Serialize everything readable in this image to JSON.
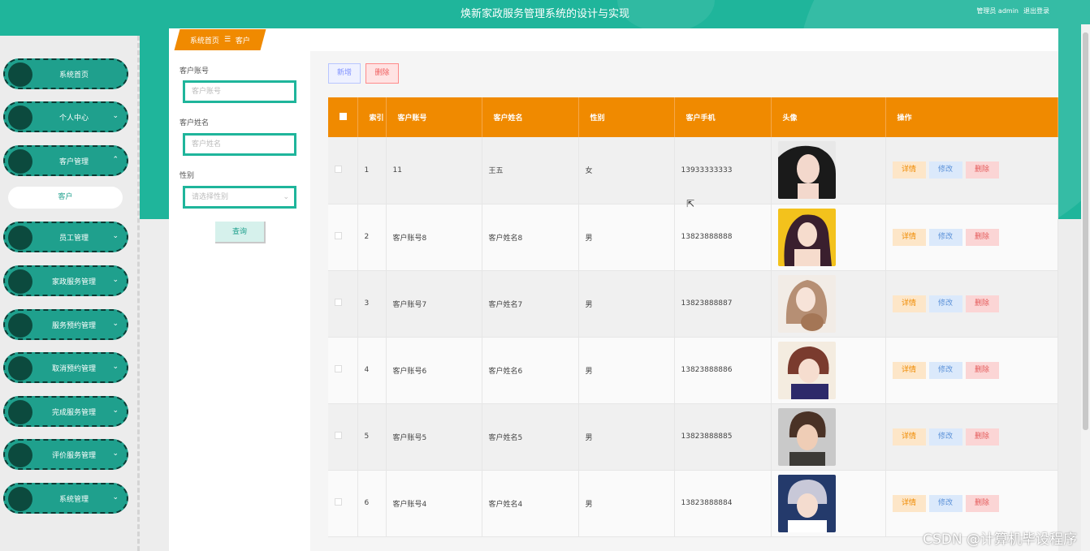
{
  "header": {
    "title": "焕新家政服务管理系统的设计与实现",
    "user_label": "管理员 admin",
    "logout_label": "退出登录"
  },
  "sidebar": {
    "items": [
      {
        "label": "系统首页"
      },
      {
        "label": "个人中心"
      },
      {
        "label": "客户管理"
      },
      {
        "label": "员工管理"
      },
      {
        "label": "家政服务管理"
      },
      {
        "label": "服务预约管理"
      },
      {
        "label": "取消预约管理"
      },
      {
        "label": "完成服务管理"
      },
      {
        "label": "评价服务管理"
      },
      {
        "label": "系统管理"
      }
    ],
    "sub_item": "客户"
  },
  "breadcrumb": {
    "home": "系统首页",
    "sep": "☰",
    "current": "客户"
  },
  "search": {
    "account_label": "客户账号",
    "account_placeholder": "客户账号",
    "name_label": "客户姓名",
    "name_placeholder": "客户姓名",
    "gender_label": "性别",
    "gender_placeholder": "请选择性别",
    "query_button": "查询"
  },
  "toolbar": {
    "add_label": "新增",
    "delete_label": "删除"
  },
  "table": {
    "headers": [
      "",
      "索引",
      "客户账号",
      "客户姓名",
      "性别",
      "客户手机",
      "头像",
      "操作"
    ],
    "rows": [
      {
        "index": "1",
        "account": "11",
        "name": "王五",
        "gender": "女",
        "phone": "13933333333"
      },
      {
        "index": "2",
        "account": "客户账号8",
        "name": "客户姓名8",
        "gender": "男",
        "phone": "13823888888"
      },
      {
        "index": "3",
        "account": "客户账号7",
        "name": "客户姓名7",
        "gender": "男",
        "phone": "13823888887"
      },
      {
        "index": "4",
        "account": "客户账号6",
        "name": "客户姓名6",
        "gender": "男",
        "phone": "13823888886"
      },
      {
        "index": "5",
        "account": "客户账号5",
        "name": "客户姓名5",
        "gender": "男",
        "phone": "13823888885"
      },
      {
        "index": "6",
        "account": "客户账号4",
        "name": "客户姓名4",
        "gender": "男",
        "phone": "13823888884"
      }
    ],
    "actions": {
      "detail": "详情",
      "edit": "修改",
      "delete": "删除"
    }
  },
  "watermark": "CSDN @计算机毕设程序",
  "colors": {
    "primary": "#1fb59b",
    "sidebar_item": "#1fa08d",
    "table_header": "#f08a00"
  }
}
